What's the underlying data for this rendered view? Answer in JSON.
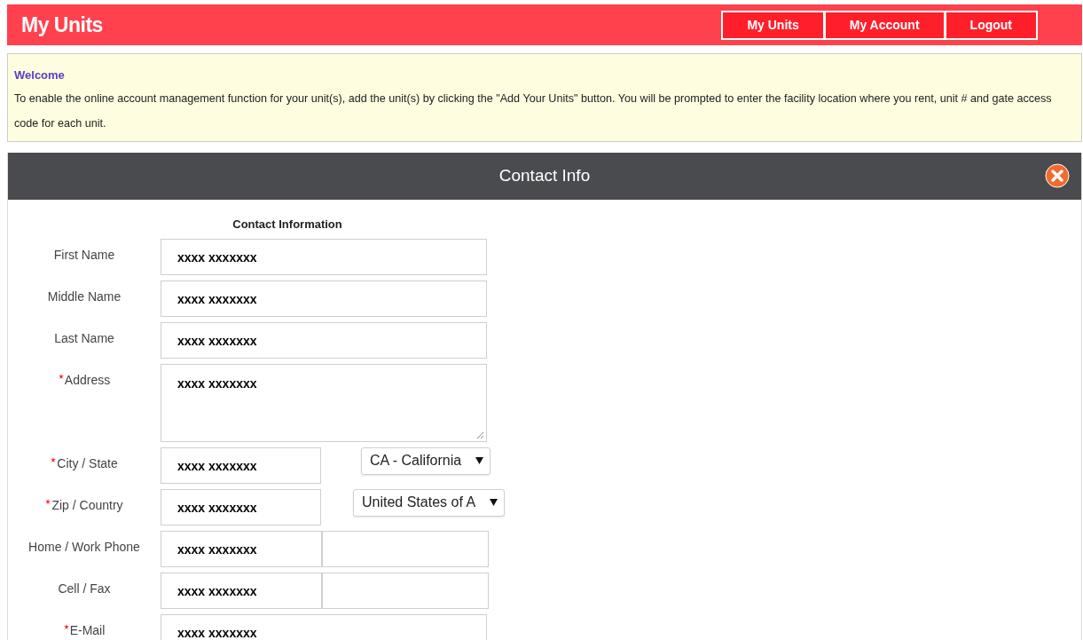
{
  "header": {
    "title": "My Units",
    "nav": [
      {
        "label": "My Units"
      },
      {
        "label": "My Account"
      },
      {
        "label": "Logout"
      }
    ]
  },
  "welcome": {
    "title": "Welcome",
    "text": "To enable the online account management function for your unit(s), add the unit(s) by clicking the \"Add Your Units\" button. You will be prompted to enter the facility location where you rent, unit # and gate access code for each unit."
  },
  "panel": {
    "title": "Contact Info",
    "section": "Contact Information",
    "fields": [
      {
        "kind": "text",
        "label": "First Name",
        "required": false,
        "value": "xxxx xxxxxxx"
      },
      {
        "kind": "text",
        "label": "Middle Name",
        "required": false,
        "value": "xxxx xxxxxxx"
      },
      {
        "kind": "text",
        "label": "Last Name",
        "required": false,
        "value": "xxxx xxxxxxx"
      },
      {
        "kind": "textarea",
        "label": "Address",
        "required": true,
        "value": "xxxx xxxxxxx"
      },
      {
        "kind": "text_select",
        "label": "City / State",
        "required": true,
        "value": "xxxx xxxxxxx",
        "select": "CA - California"
      },
      {
        "kind": "text_select",
        "label": "Zip / Country",
        "required": true,
        "value": "xxxx xxxxxxx",
        "select": "United States of A"
      },
      {
        "kind": "text_pair",
        "label": "Home / Work Phone",
        "required": false,
        "value": "xxxx xxxxxxx"
      },
      {
        "kind": "text_pair",
        "label": "Cell / Fax",
        "required": false,
        "value": "xxxx xxxxxxx"
      },
      {
        "kind": "text",
        "label": "E-Mail",
        "required": true,
        "value": "xxxx xxxxxxx"
      }
    ]
  }
}
